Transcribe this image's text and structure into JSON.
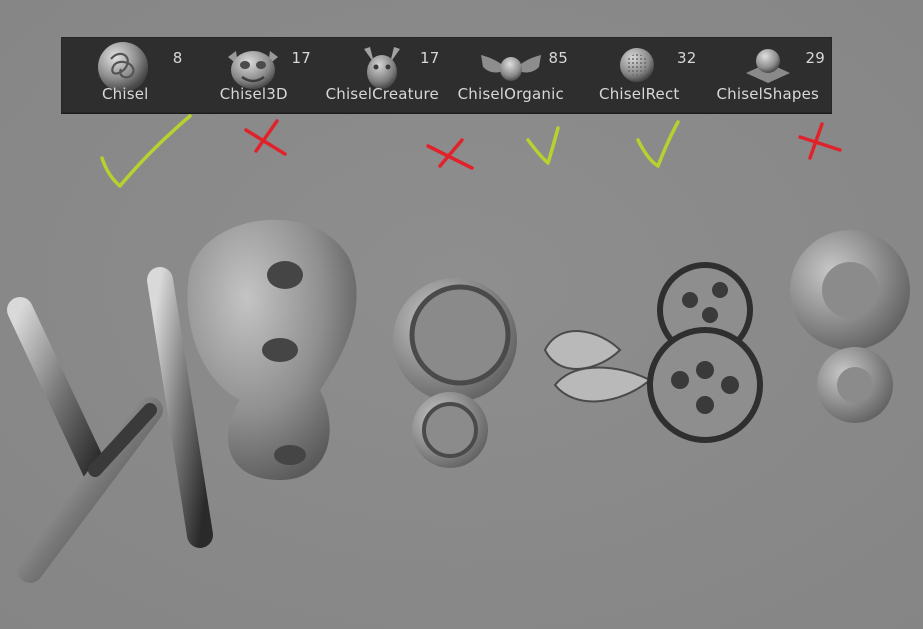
{
  "palette": {
    "brushes": [
      {
        "label": "Chisel",
        "count": "8",
        "icon": "chisel-knot-sphere-icon"
      },
      {
        "label": "Chisel3D",
        "count": "17",
        "icon": "chisel-monster-head-icon"
      },
      {
        "label": "ChiselCreature",
        "count": "17",
        "icon": "chisel-creature-head-icon"
      },
      {
        "label": "ChiselOrganic",
        "count": "85",
        "icon": "chisel-organic-wings-icon"
      },
      {
        "label": "ChiselRect",
        "count": "32",
        "icon": "chisel-rect-mesh-sphere-icon"
      },
      {
        "label": "ChiselShapes",
        "count": "29",
        "icon": "chisel-shapes-plate-sphere-icon"
      }
    ]
  },
  "annotations": {
    "check_color": "#b8d12f",
    "cross_color": "#e0232a"
  },
  "colors": {
    "canvas": "#8b8b8b",
    "palette_bg": "#2e2e2e",
    "text": "#d8d8d8"
  }
}
